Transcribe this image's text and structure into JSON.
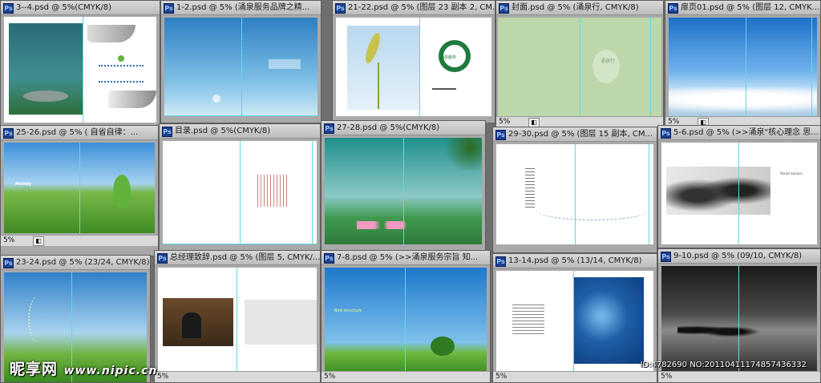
{
  "app": {
    "name": "Adobe Photoshop document windows",
    "icon_text": "Ps"
  },
  "windows": [
    {
      "title": "3--4.psd @ 5%(CMYK/8)",
      "zoom": ""
    },
    {
      "title": "1-2.psd @ 5% (涌泉服务品牌之精...",
      "zoom": ""
    },
    {
      "title": "21-22.psd @ 5% (图层 23 副本 2, CM...",
      "zoom": ""
    },
    {
      "title": "封面.psd @ 5% (涌泉行, CMYK/8)",
      "zoom": "5%"
    },
    {
      "title": "扉页01.psd @ 5% (图层 12, CMYK...",
      "zoom": "5%"
    },
    {
      "title": "25-26.psd @ 5% (   自省自律：...",
      "zoom": "5%"
    },
    {
      "title": "目录.psd @ 5%(CMYK/8)",
      "zoom": ""
    },
    {
      "title": "27-28.psd @ 5%(CMYK/8)",
      "zoom": ""
    },
    {
      "title": "29-30.psd @ 5% (图层 15 副本, CM...",
      "zoom": ""
    },
    {
      "title": "5-6.psd @ 5% (>>涌泉\"核心理念 思...",
      "zoom": ""
    },
    {
      "title": "23-24.psd @ 5% (23/24, CMYK/8)",
      "zoom": ""
    },
    {
      "title": "总经理致辞.psd @ 5% (图层 5, CMYK/...",
      "zoom": "5%"
    },
    {
      "title": "7-8.psd @ 5% (>>涌泉服务宗旨 知...",
      "zoom": "5%"
    },
    {
      "title": "13-14.psd @ 5% (13/14, CMYK/8)",
      "zoom": "5%"
    },
    {
      "title": "9-10.psd @ 5% (09/10, CMYK/8)",
      "zoom": "5%"
    }
  ],
  "canvas_text": {
    "logo_caption": "涌泉服务",
    "cover_title": "涌泉行",
    "melody": "Melody",
    "bird_text": "Bird structure",
    "horse_text": "Smart service"
  },
  "watermark": {
    "site_cn": "昵享网",
    "site_url": "www.nipic.cn",
    "id_text": "ID:4782690 NO:20110411174857436332"
  },
  "colors": {
    "guide": "#5fd7e6",
    "sky": "#3b8fd6",
    "grass": "#4a9a2a"
  }
}
